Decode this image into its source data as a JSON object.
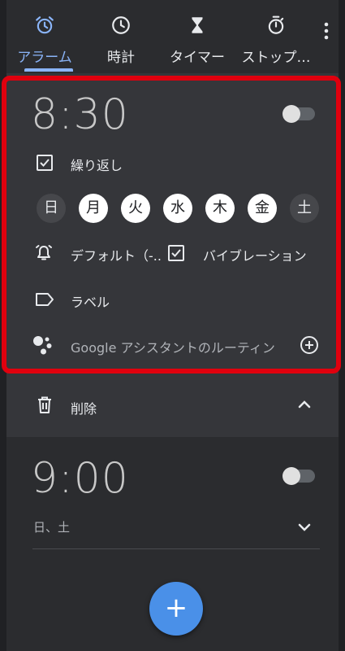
{
  "tabs": [
    {
      "label": "アラーム",
      "icon": "alarm-icon",
      "active": true
    },
    {
      "label": "時計",
      "icon": "clock-icon",
      "active": false
    },
    {
      "label": "タイマー",
      "icon": "hourglass-icon",
      "active": false
    },
    {
      "label": "ストップ…",
      "icon": "stopwatch-icon",
      "active": false
    }
  ],
  "colors": {
    "accent": "#8ab4f8",
    "highlight": "#e0000e",
    "fab": "#4a90e8"
  },
  "alarm1": {
    "time": "8:30",
    "enabled": false,
    "repeat_label": "繰り返し",
    "repeat_checked": true,
    "days": [
      {
        "label": "日",
        "on": false
      },
      {
        "label": "月",
        "on": true
      },
      {
        "label": "火",
        "on": true
      },
      {
        "label": "水",
        "on": true
      },
      {
        "label": "木",
        "on": true
      },
      {
        "label": "金",
        "on": true
      },
      {
        "label": "土",
        "on": false
      }
    ],
    "sound_label": "デフォルト（-..",
    "vibration_label": "バイブレーション",
    "vibration_checked": true,
    "label_text": "ラベル",
    "assistant_text": "Google アシスタントのルーティン",
    "delete_label": "削除"
  },
  "alarm2": {
    "time": "9:00",
    "enabled": false,
    "days_summary": "日、土"
  },
  "fab": {
    "label": "+"
  }
}
